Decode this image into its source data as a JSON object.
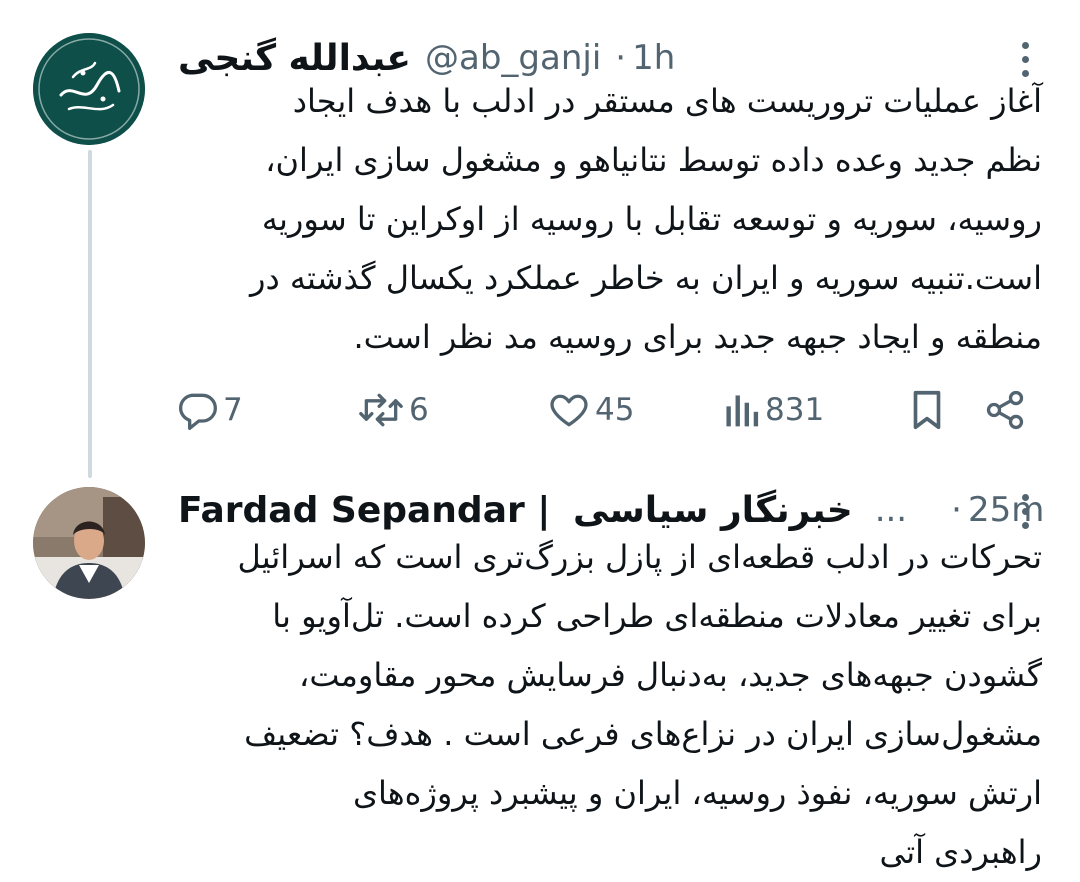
{
  "tweets": [
    {
      "author": "عبدالله گنجی",
      "handle": "@ab_ganji",
      "separator": "·",
      "time": "1h",
      "avatar_icon": "calligraphy-logo-icon",
      "avatar_logo_text": "عبدالله گنجی",
      "text": "آغاز عملیات تروریست های مستقر در ادلب با هدف ایجاد\nنظم جدید وعده داده توسط نتانیاهو و مشغول سازی ایران،\nروسیه، سوریه و توسعه تقابل با روسیه از اوکراین تا سوریه\nاست.تنبیه سوریه و ایران به خاطر عملکرد یکسال گذشته در\nمنطقه و ایجاد جبهه جدید برای روسیه مد نظر است.",
      "stats": {
        "replies": "7",
        "retweets": "6",
        "likes": "45",
        "views": "831"
      }
    },
    {
      "author": "Fardad Sepandar | خبرنگار سیاسی",
      "author_latin": "Fardad Sepandar |",
      "author_farsi": "خبرنگار سیاسی",
      "ellipsis": "...",
      "separator": "·",
      "time": "25m",
      "avatar_icon": "user-photo-avatar",
      "text": "تحرکات در ادلب قطعه‌ای از پازل بزرگ‌تری است که اسرائیل\nبرای تغییر معادلات منطقه‌ای طراحی کرده است. تل‌آویو با\nگشودن جبهه‌های جدید، به‌دنبال فرسایش محور مقاومت،\nمشغول‌سازی ایران در نزاع‌های فرعی است . هدف؟ تضعیف\nارتش سوریه،  نفوذ روسیه، ایران و پیشبرد پروژه‌های\nراهبردی آتی"
    }
  ],
  "icons": [
    "reply-icon",
    "retweet-icon",
    "like-icon",
    "views-icon",
    "bookmark-icon",
    "share-icon",
    "more-options-icon"
  ],
  "colors": {
    "text": "#0f1419",
    "secondary": "#536471",
    "thread_line": "#cfd9de",
    "avatar_green": "#0f4f49"
  }
}
